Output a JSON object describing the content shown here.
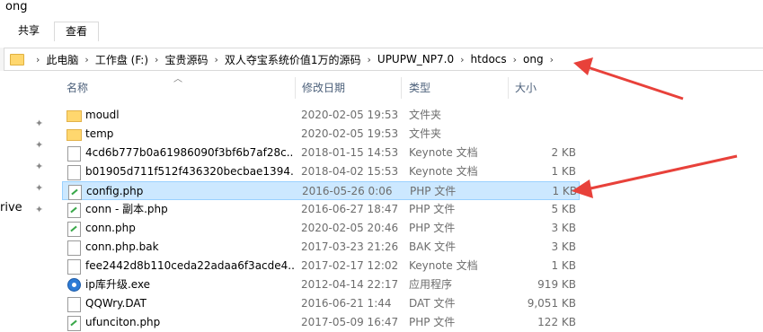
{
  "window": {
    "title": "ong"
  },
  "ribbon": {
    "tabs": [
      "共享",
      "查看"
    ]
  },
  "address": {
    "crumbs": [
      "此电脑",
      "工作盘 (F:)",
      "宝贵源码",
      "双人夺宝系统价值1万的源码",
      "UPUPW_NP7.0",
      "htdocs",
      "ong"
    ]
  },
  "columns": {
    "name": "名称",
    "date": "修改日期",
    "type": "类型",
    "size": "大小"
  },
  "nav": {
    "partial_label": "rive"
  },
  "files": [
    {
      "name": "moudl",
      "date": "2020-02-05 19:53",
      "type": "文件夹",
      "size": "",
      "icon": "folder-icon"
    },
    {
      "name": "temp",
      "date": "2020-02-05 19:53",
      "type": "文件夹",
      "size": "",
      "icon": "folder-icon"
    },
    {
      "name": "4cd6b777b0a61986090f3bf6b7af28c...",
      "date": "2018-01-15 14:53",
      "type": "Keynote 文档",
      "size": "2 KB",
      "icon": "document-icon"
    },
    {
      "name": "b01905d711f512f436320becbae1394...",
      "date": "2018-04-02 15:53",
      "type": "Keynote 文档",
      "size": "1 KB",
      "icon": "document-icon"
    },
    {
      "name": "config.php",
      "date": "2016-05-26 0:06",
      "type": "PHP 文件",
      "size": "1 KB",
      "icon": "php-file-icon",
      "selected": true
    },
    {
      "name": "conn - 副本.php",
      "date": "2016-06-27 18:47",
      "type": "PHP 文件",
      "size": "5 KB",
      "icon": "php-file-icon"
    },
    {
      "name": "conn.php",
      "date": "2020-02-05 20:46",
      "type": "PHP 文件",
      "size": "3 KB",
      "icon": "php-file-icon"
    },
    {
      "name": "conn.php.bak",
      "date": "2017-03-23 21:26",
      "type": "BAK 文件",
      "size": "3 KB",
      "icon": "document-icon"
    },
    {
      "name": "fee2442d8b110ceda22adaa6f3acde4...",
      "date": "2017-02-17 12:02",
      "type": "Keynote 文档",
      "size": "1 KB",
      "icon": "document-icon"
    },
    {
      "name": "ip库升级.exe",
      "date": "2012-04-14 22:17",
      "type": "应用程序",
      "size": "919 KB",
      "icon": "application-icon"
    },
    {
      "name": "QQWry.DAT",
      "date": "2016-06-21 1:44",
      "type": "DAT 文件",
      "size": "9,051 KB",
      "icon": "document-icon"
    },
    {
      "name": "ufunciton.php",
      "date": "2017-05-09 16:47",
      "type": "PHP 文件",
      "size": "122 KB",
      "icon": "php-file-icon"
    }
  ],
  "colors": {
    "selection_bg": "#cce8ff",
    "selection_border": "#99d1ff",
    "annotation_arrow": "#e8413a",
    "header_text": "#4c607a"
  }
}
